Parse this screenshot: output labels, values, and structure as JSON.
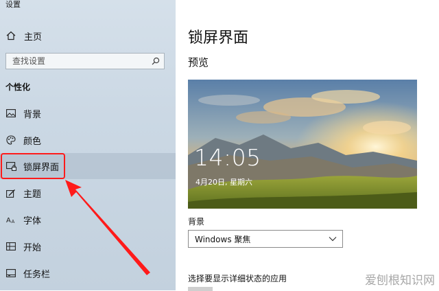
{
  "window": {
    "title": "设置"
  },
  "sidebar": {
    "home_label": "主页",
    "search_placeholder": "查找设置",
    "section_label": "个性化",
    "items": [
      {
        "label": "背景",
        "icon": "image-icon"
      },
      {
        "label": "颜色",
        "icon": "palette-icon"
      },
      {
        "label": "锁屏界面",
        "icon": "lock-screen-icon",
        "active": true
      },
      {
        "label": "主题",
        "icon": "theme-brush-icon"
      },
      {
        "label": "字体",
        "icon": "font-icon"
      },
      {
        "label": "开始",
        "icon": "start-grid-icon"
      },
      {
        "label": "任务栏",
        "icon": "taskbar-icon"
      }
    ]
  },
  "main": {
    "title": "锁屏界面",
    "preview_label": "预览",
    "preview": {
      "time": "14:05",
      "date": "4月20日, 星期六"
    },
    "background_label": "背景",
    "background_value": "Windows 聚焦",
    "detail_label": "选择要显示详细状态的应用"
  },
  "annotation": {
    "color": "#ff1a1a"
  },
  "watermark": "爱刨根知识网"
}
